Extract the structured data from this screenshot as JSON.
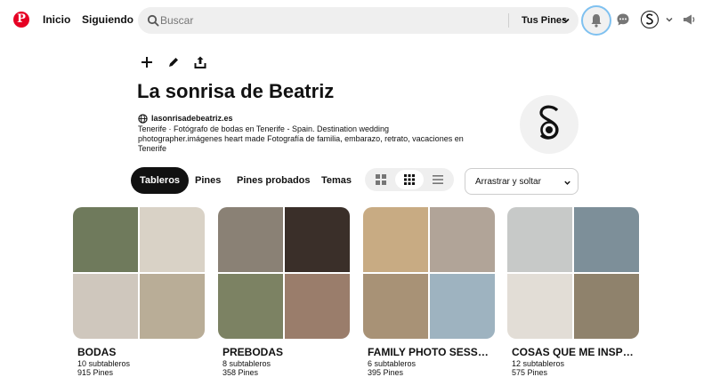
{
  "header": {
    "logo": "P",
    "nav": {
      "home": "Inicio",
      "following": "Siguiendo"
    },
    "search": {
      "placeholder": "Buscar",
      "scope": "Tus Pines"
    }
  },
  "profile": {
    "name": "La sonrisa de Beatriz",
    "website": "lasonrisadebeatriz.es",
    "bio": "Tenerife · Fotógrafo de bodas en Tenerife - Spain. Destination wedding photographer.imágenes heart made Fotografía de familia, embarazo, retrato, vacaciones en Tenerife"
  },
  "tabs": [
    "Tableros",
    "Pines",
    "Pines probados",
    "Temas"
  ],
  "sort": {
    "label": "Arrastrar y soltar"
  },
  "boards": [
    {
      "title": "BODAS",
      "subboards": "10 subtableros",
      "pins": "915 Pines",
      "colors": [
        "#6f7a5c",
        "#d9d2c6",
        "#cfc7bd",
        "#b9ad97"
      ]
    },
    {
      "title": "PREBODAS",
      "subboards": "8 subtableros",
      "pins": "358 Pines",
      "colors": [
        "#8a8175",
        "#3a2f29",
        "#7c8263",
        "#9a7d6b"
      ]
    },
    {
      "title": "FAMILY PHOTO SESS…",
      "subboards": "6 subtableros",
      "pins": "395 Pines",
      "colors": [
        "#c8ab83",
        "#b1a498",
        "#a89276",
        "#9eb3c0"
      ]
    },
    {
      "title": "COSAS QUE ME INSP…",
      "subboards": "12 subtableros",
      "pins": "575 Pines",
      "colors": [
        "#c7c9c8",
        "#7d8f99",
        "#e2ddd6",
        "#8f826c"
      ]
    }
  ],
  "colors": {
    "brand": "#e60023",
    "active_tab": "#111111",
    "focus_ring": "#7fc1f0"
  }
}
